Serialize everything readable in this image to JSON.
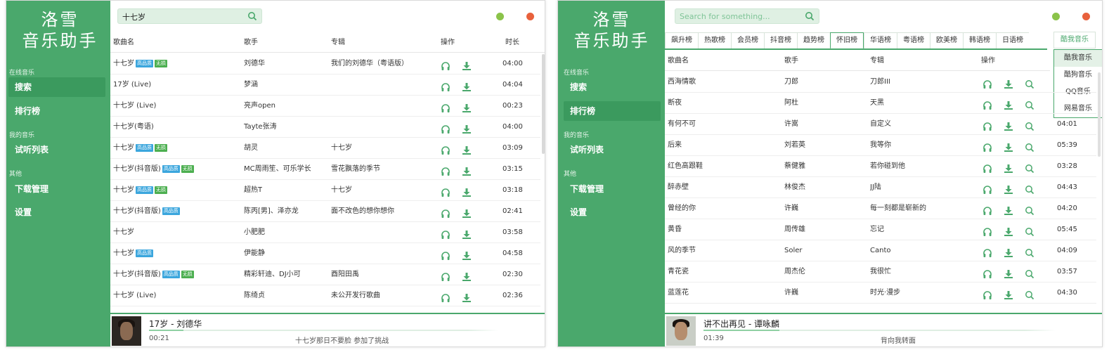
{
  "colors": {
    "accent": "#4aa86c",
    "accent_dark": "#3b9a5e",
    "badge_hq": "#3ba6dd",
    "badge_lossless": "#4caf50",
    "dot_green": "#8bc34a",
    "dot_red": "#e8613c"
  },
  "app": {
    "logo_line1": "洛雪",
    "logo_line2": "音乐助手",
    "nav": {
      "online_section": "在线音乐",
      "search": "搜索",
      "charts": "排行榜",
      "my_section": "我的音乐",
      "playlist": "试听列表",
      "other_section": "其他",
      "downloads": "下载管理",
      "settings": "设置"
    }
  },
  "window1": {
    "search_value": "十七岁",
    "columns": {
      "name": "歌曲名",
      "artist": "歌手",
      "album": "专辑",
      "ops": "操作",
      "duration": "时长"
    },
    "badges": {
      "hq": "高品质",
      "lossless": "无损"
    },
    "rows": [
      {
        "name": "十七岁",
        "hq": true,
        "lossless": true,
        "artist": "刘德华",
        "album": "我们的刘德华（粤语版）",
        "duration": "04:00"
      },
      {
        "name": "17岁 (Live)",
        "hq": false,
        "lossless": false,
        "artist": "梦涵",
        "album": "",
        "duration": "04:04"
      },
      {
        "name": "十七岁 (Live)",
        "hq": false,
        "lossless": false,
        "artist": "亮声open",
        "album": "",
        "duration": "00:23"
      },
      {
        "name": "十七岁(粤语)",
        "hq": false,
        "lossless": false,
        "artist": "Tayte张涛",
        "album": "",
        "duration": "04:00"
      },
      {
        "name": "十七岁",
        "hq": true,
        "lossless": true,
        "artist": "胡灵",
        "album": "十七岁",
        "duration": "03:09"
      },
      {
        "name": "十七岁(抖音版)",
        "hq": true,
        "lossless": true,
        "artist": "MC周雨笙、可乐学长",
        "album": "雪花飘落的季节",
        "duration": "03:15"
      },
      {
        "name": "十七岁",
        "hq": true,
        "lossless": true,
        "artist": "超热T",
        "album": "十七岁",
        "duration": "03:18"
      },
      {
        "name": "十七岁(抖音版)",
        "hq": true,
        "lossless": false,
        "artist": "陈丙[男]、泽亦龙",
        "album": "面不改色的想你想你",
        "duration": "02:41"
      },
      {
        "name": "十七岁",
        "hq": false,
        "lossless": false,
        "artist": "小肥肥",
        "album": "",
        "duration": "03:58"
      },
      {
        "name": "十七岁",
        "hq": true,
        "lossless": false,
        "artist": "伊能静",
        "album": "",
        "duration": "04:58"
      },
      {
        "name": "十七岁(抖音版)",
        "hq": true,
        "lossless": true,
        "artist": "精彩轩迪、DJ小可",
        "album": "酉阳田禹",
        "duration": "02:30"
      },
      {
        "name": "十七岁 (Live)",
        "hq": false,
        "lossless": false,
        "artist": "陈绮贞",
        "album": "未公开发行歌曲",
        "duration": "02:36"
      }
    ],
    "player": {
      "title": "17岁 - 刘德华",
      "time": "00:21",
      "progress": 0.09,
      "lyric": "十七岁那日不要脸 参加了挑战"
    }
  },
  "window2": {
    "search_placeholder": "Search for something...",
    "tabs": [
      "飙升榜",
      "热歌榜",
      "会员榜",
      "抖音榜",
      "趋势榜",
      "怀旧榜",
      "华语榜",
      "粤语榜",
      "欧美榜",
      "韩语榜",
      "日语榜"
    ],
    "active_tab": 5,
    "source_button": "酷我音乐",
    "source_options": [
      "酷我音乐",
      "酷狗音乐",
      "QQ音乐",
      "网易音乐"
    ],
    "source_selected": 0,
    "columns": {
      "name": "歌曲名",
      "artist": "歌手",
      "album": "专辑",
      "ops": "操作"
    },
    "rows": [
      {
        "name": "西海情歌",
        "artist": "刀郎",
        "album": "刀郎III",
        "duration": ""
      },
      {
        "name": "断夜",
        "artist": "阿杜",
        "album": "天黑",
        "duration": ""
      },
      {
        "name": "有何不可",
        "artist": "许嵩",
        "album": "自定义",
        "duration": "04:01"
      },
      {
        "name": "后来",
        "artist": "刘若英",
        "album": "我等你",
        "duration": "05:39"
      },
      {
        "name": "红色高跟鞋",
        "artist": "蔡健雅",
        "album": "若你碰到他",
        "duration": "03:28"
      },
      {
        "name": "醉赤壁",
        "artist": "林俊杰",
        "album": "JJ陆",
        "duration": "04:43"
      },
      {
        "name": "曾经的你",
        "artist": "许巍",
        "album": "每一刻都是崭新的",
        "duration": "04:20"
      },
      {
        "name": "黄昏",
        "artist": "周传雄",
        "album": "忘记",
        "duration": "05:45"
      },
      {
        "name": "风的季节",
        "artist": "Soler",
        "album": "Canto",
        "duration": "04:09"
      },
      {
        "name": "青花瓷",
        "artist": "周杰伦",
        "album": "我很忙",
        "duration": "03:57"
      },
      {
        "name": "蓝莲花",
        "artist": "许巍",
        "album": "时光·漫步",
        "duration": "04:30"
      }
    ],
    "player": {
      "title": "讲不出再见 - 谭咏麟",
      "time": "01:39",
      "progress": 0.2,
      "lyric": "背向我转面"
    }
  }
}
